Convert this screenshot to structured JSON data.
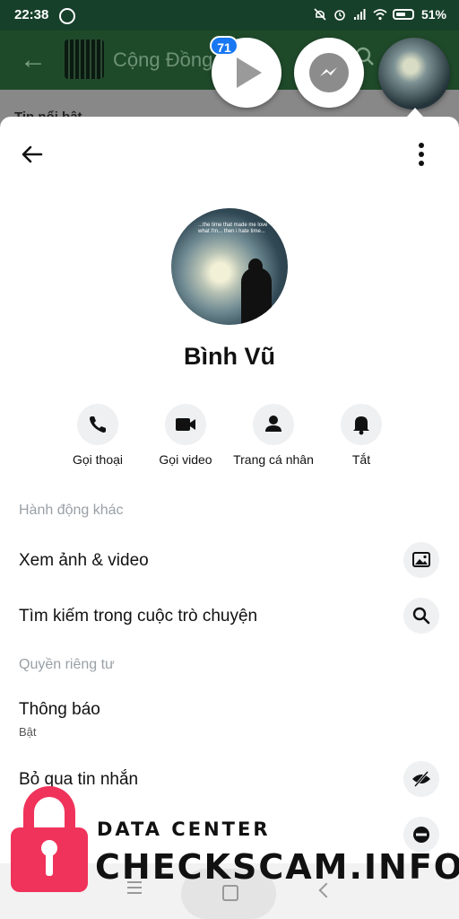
{
  "status_bar": {
    "time": "22:38",
    "battery": "51%"
  },
  "background_app": {
    "title": "Cộng Đồng",
    "underlay_text": "Tin nổi bật"
  },
  "chat_heads": {
    "badge_count": "71"
  },
  "profile": {
    "name": "Bình Vũ",
    "avatar_quote": "...the time that made me love what I'm... then i hate time..."
  },
  "actions": [
    {
      "label": "Gọi thoại",
      "icon": "phone-icon"
    },
    {
      "label": "Gọi video",
      "icon": "video-camera-icon"
    },
    {
      "label": "Trang cá nhân",
      "icon": "person-icon"
    },
    {
      "label": "Tắt",
      "icon": "bell-icon"
    }
  ],
  "sections": {
    "more_actions": {
      "title": "Hành động khác",
      "items": [
        {
          "label": "Xem ảnh & video",
          "icon": "image-icon"
        },
        {
          "label": "Tìm kiếm trong cuộc trò chuyện",
          "icon": "search-icon"
        }
      ]
    },
    "privacy": {
      "title": "Quyền riêng tư",
      "items": [
        {
          "label": "Thông báo",
          "sublabel": "Bật"
        },
        {
          "label": "Bỏ qua tin nhắn",
          "icon": "ignore-icon"
        },
        {
          "label": "",
          "icon": "block-icon"
        }
      ]
    }
  },
  "watermark": {
    "line1": "DATA CENTER",
    "line2": "CHECKSCAM.INFO",
    "color": "#f0335b"
  }
}
